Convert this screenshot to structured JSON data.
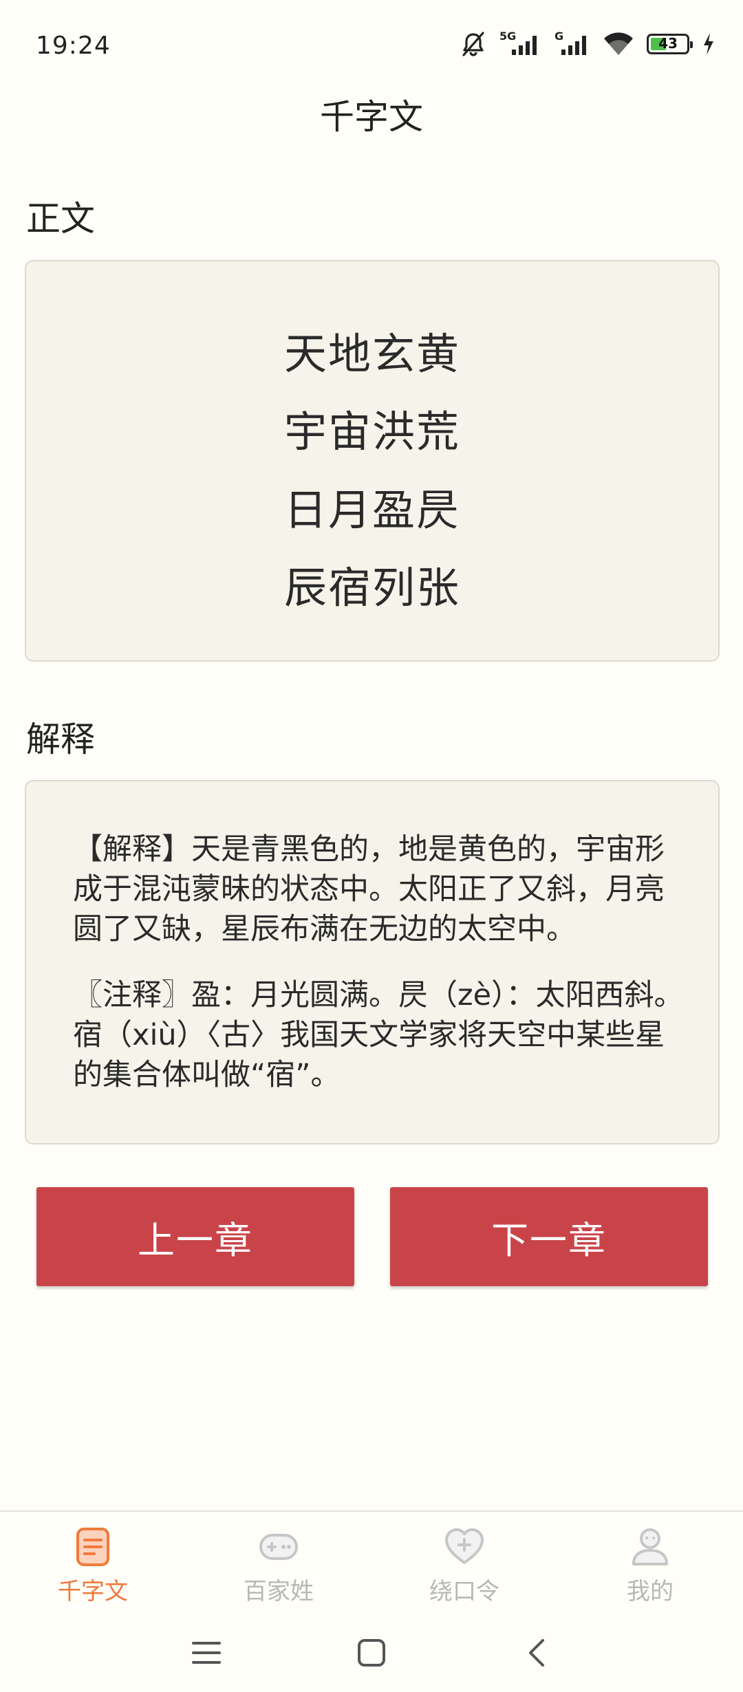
{
  "status_bar": {
    "time": "19:24",
    "network_label_1": "5G",
    "network_label_2": "G",
    "battery_level": "43",
    "battery_fraction": 0.43,
    "icons": [
      "mute-bell-icon",
      "signal-icon",
      "signal-icon",
      "wifi-icon",
      "battery-icon",
      "charging-icon"
    ]
  },
  "header": {
    "title": "千字文"
  },
  "text_section": {
    "heading": "正文",
    "lines": [
      "天地玄黄",
      "宇宙洪荒",
      "日月盈昃",
      "辰宿列张"
    ]
  },
  "explain_section": {
    "heading": "解释",
    "paragraphs": [
      "【解释】天是青黑色的，地是黄色的，宇宙形成于混沌蒙昧的状态中。太阳正了又斜，月亮圆了又缺，星辰布满在无边的太空中。",
      "〖注释〗盈：月光圆满。昃（zè）：太阳西斜。宿（xiù）〈古〉我国天文学家将天空中某些星的集合体叫做“宿”。"
    ]
  },
  "buttons": {
    "prev": "上一章",
    "next": "下一章"
  },
  "tabs": [
    {
      "label": "千字文",
      "icon": "document-icon",
      "active": true
    },
    {
      "label": "百家姓",
      "icon": "gamepad-icon",
      "active": false
    },
    {
      "label": "绕口令",
      "icon": "heart-plus-icon",
      "active": false
    },
    {
      "label": "我的",
      "icon": "person-icon",
      "active": false
    }
  ],
  "colors": {
    "background": "#fffef8",
    "card": "#f6f4ea",
    "button": "#c94449",
    "active_tab": "#f07a3a",
    "inactive_tab": "#b7b7b7"
  }
}
